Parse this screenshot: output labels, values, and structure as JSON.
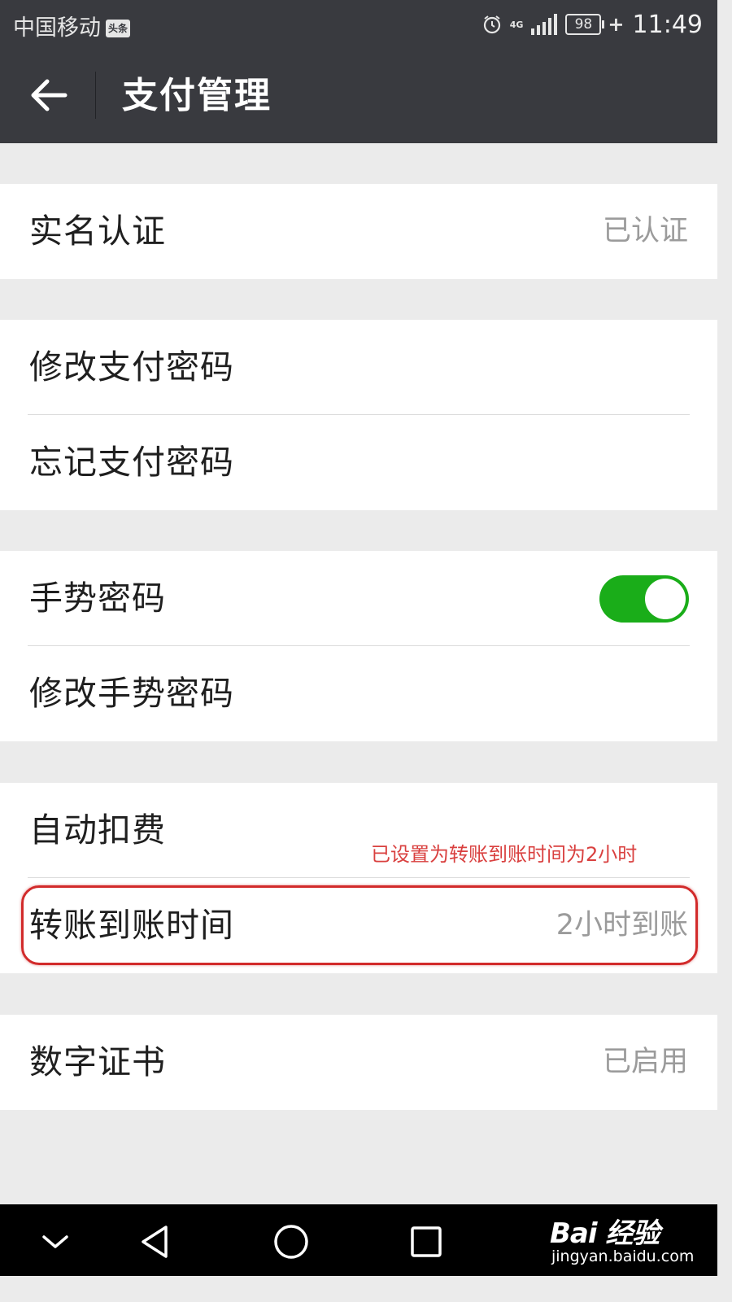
{
  "status_bar": {
    "carrier": "中国移动",
    "carrier_badge": "头条",
    "network": "4G",
    "battery": "98",
    "time": "11:49"
  },
  "app_bar": {
    "title": "支付管理"
  },
  "groups": [
    {
      "items": [
        {
          "label": "实名认证",
          "value": "已认证"
        }
      ]
    },
    {
      "items": [
        {
          "label": "修改支付密码"
        },
        {
          "label": "忘记支付密码"
        }
      ]
    },
    {
      "items": [
        {
          "label": "手势密码",
          "toggle_on": true
        },
        {
          "label": "修改手势密码"
        }
      ]
    },
    {
      "items": [
        {
          "label": "自动扣费"
        },
        {
          "label": "转账到账时间",
          "value": "2小时到账"
        }
      ]
    },
    {
      "items": [
        {
          "label": "数字证书",
          "value": "已启用"
        }
      ]
    }
  ],
  "annotation": "已设置为转账到账时间为2小时",
  "watermark": {
    "logo": "Bai  经验",
    "sub": "jingyan.baidu.com"
  },
  "colors": {
    "toolbar": "#393a3f",
    "toggle_on": "#1aad19",
    "annotation": "#d9403f"
  },
  "icons": {
    "back": "arrow-left-icon",
    "nav": [
      "chevron-down-icon",
      "back-triangle-icon",
      "home-circle-icon",
      "recent-square-icon"
    ]
  }
}
